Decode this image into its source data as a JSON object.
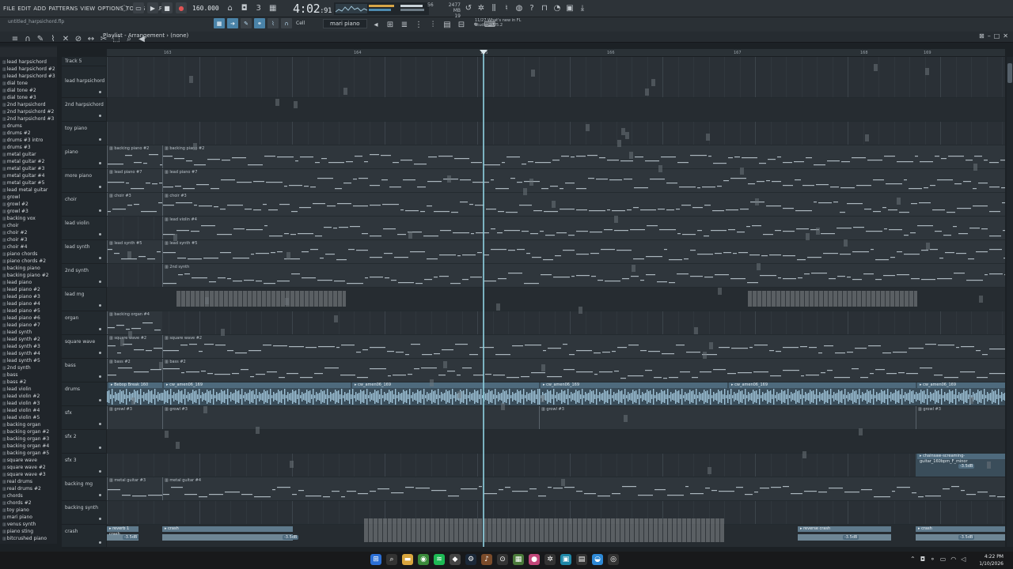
{
  "menus": [
    "FILE",
    "EDIT",
    "ADD",
    "PATTERNS",
    "VIEW",
    "OPTIONS",
    "TOOLS",
    "HELP"
  ],
  "transport": {
    "tempo": "160.000",
    "time_main": "4:02",
    "time_sub": "91",
    "cpu": "56",
    "memory": "2477 MB",
    "voices": "19"
  },
  "project": {
    "filename": "untitled_harpsichord.flp"
  },
  "toolbar": {
    "snap": "Cell",
    "pattern": "mari piano",
    "news_line1": "11/27  What's new in FL",
    "news_line2": "Studio 2025.2"
  },
  "playlist": {
    "title": "Playlist - Arrangement › (none)",
    "first_track": "Track 5"
  },
  "ruler": [
    "163",
    "",
    "",
    "164",
    "",
    "165",
    "",
    "166",
    "",
    "167",
    "",
    "168",
    "169"
  ],
  "patterns": [
    "lead harpsichord",
    "lead harpsichord #2",
    "lead harpsichord #3",
    "dial tone",
    "dial tone #2",
    "dial tone #3",
    "2nd harpsichord",
    "2nd harpsichord #2",
    "2nd harpsichord #3",
    "drums",
    "drums #2",
    "drums #3 intro",
    "drums #3",
    "metal guitar",
    "metal guitar #2",
    "metal guitar #3",
    "metal guitar #4",
    "metal guitar #5",
    "lead metal guitar",
    "growl",
    "growl #2",
    "growl #3",
    "backing vox",
    "choir",
    "choir #2",
    "choir #3",
    "choir #4",
    "piano chords",
    "piano chords #2",
    "backing piano",
    "backing piano #2",
    "lead piano",
    "lead piano #2",
    "lead piano #3",
    "lead piano #4",
    "lead piano #5",
    "lead piano #6",
    "lead piano #7",
    "lead synth",
    "lead synth #2",
    "lead synth #3",
    "lead synth #4",
    "lead synth #5",
    "2nd synth",
    "bass",
    "bass #2",
    "lead violin",
    "lead violin #2",
    "lead violin #3",
    "lead violin #4",
    "lead violin #5",
    "backing organ",
    "backing organ #2",
    "backing organ #3",
    "backing organ #4",
    "backing organ #5",
    "square wave",
    "square wave #2",
    "square wave #3",
    "real drums",
    "real drums #2",
    "chords",
    "chords #2",
    "toy piano",
    "mari piano",
    "venus synth",
    "piano sting",
    "bitcrushed piano"
  ],
  "tracks": [
    "lead harpsichord",
    "2nd harpsichord",
    "toy piano",
    "piano",
    "more piano",
    "choir",
    "lead violin",
    "lead synth",
    "2nd synth",
    "lead mg",
    "organ",
    "square wave",
    "bass",
    "drums",
    "sfx",
    "sfx 2",
    "sfx 3",
    "backing mg",
    "backing synth",
    "crash"
  ],
  "clips": {
    "piano": [
      "backing piano #2",
      "backing piano #2"
    ],
    "more_piano": [
      "lead piano #7",
      "lead piano #7"
    ],
    "choir": [
      "choir #3",
      "choir #3"
    ],
    "lead_violin": [
      "lead violin #4"
    ],
    "lead_synth": [
      "lead synth #5",
      "lead synth #5"
    ],
    "second_synth": [
      "2nd synth"
    ],
    "organ": [
      "backing organ #4"
    ],
    "square_wave": [
      "square wave #2",
      "square wave #2"
    ],
    "bass": [
      "bass #2",
      "bass #2"
    ],
    "drums": [
      "Bebop Break 160",
      "cw_amen06_169",
      "cw_amen06_169",
      "cw_amen06_169",
      "cw_amen06_169",
      "cw_amen06_169"
    ],
    "sfx": [
      "growl #3",
      "growl #3",
      "growl #3",
      "growl #3"
    ],
    "sfx3": [
      "chainsaw-screaming-guitar_160bpm_F_minor"
    ],
    "backing_mg": [
      "metal guitar #3",
      "metal guitar #4"
    ],
    "crash": [
      "reverb 1 crash",
      "crash",
      "reverse crash",
      "crash"
    ],
    "db_labels": [
      "-3.5dB",
      "-3.5dB",
      "-3.5dB",
      "-3.5dB",
      "-3.5dB"
    ]
  },
  "taskbar": {
    "time": "4:22 PM",
    "date": "1/10/2026"
  },
  "colors": {
    "accent": "#4a83a8",
    "playhead": "#8ac9d8",
    "audio": "#9fc3d8",
    "notes": "#b8c4cc"
  }
}
